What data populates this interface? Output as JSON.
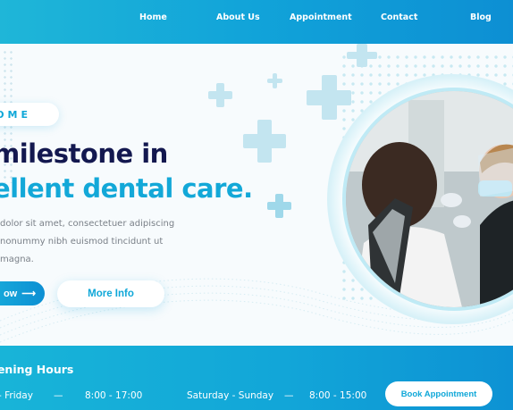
{
  "nav": {
    "logo_fragment": "",
    "items": [
      "Home",
      "About Us",
      "Appointment",
      "Contact",
      "Blog"
    ]
  },
  "hero": {
    "badge": "OME",
    "headline_line1": "milestone in",
    "headline_line2": "ellent dental care.",
    "paragraph_lines": [
      "dolor sit amet, consectetuer adipiscing",
      "nonummy nibh euismod tincidunt ut",
      "magna."
    ],
    "primary_button": "ow",
    "primary_button_arrow": "⟶",
    "secondary_button": "More Info"
  },
  "hours": {
    "title": "pening Hours",
    "weekday_days": "- Friday",
    "weekday_sep": "—",
    "weekday_time": "8:00 - 17:00",
    "weekend_days": "Saturday - Sunday",
    "weekend_sep": "—",
    "weekend_time": "8:00 - 15:00",
    "book_button": "Book Appointment"
  },
  "colors": {
    "brand_blue": "#11a3d9",
    "navy": "#13184f",
    "accent_cyan": "#13a8d8"
  },
  "icons": {
    "decor": "medical-cross-icon",
    "arrow": "arrow-right-icon"
  }
}
